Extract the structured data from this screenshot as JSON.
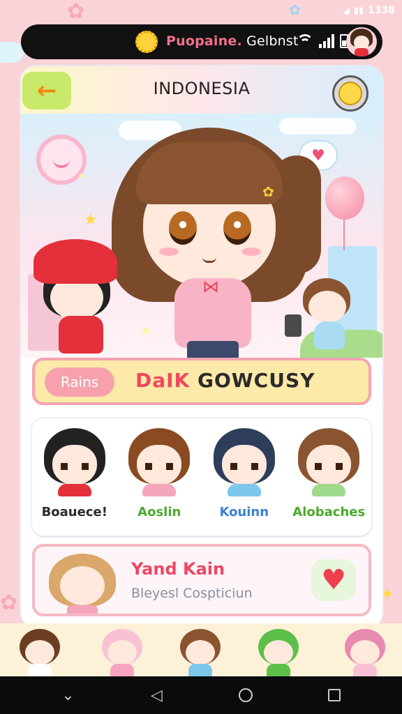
{
  "status_bar": {
    "time": "1338"
  },
  "notification": {
    "title_accent": "Puopaine.",
    "title_rest": " Gelbnst"
  },
  "header": {
    "back_icon": "arrow-left-icon",
    "title": "INDONESIA",
    "badge_icon": "coin-badge-icon"
  },
  "banner": {
    "tag": "Rains",
    "name_part1": "DaIK ",
    "name_part2": "GOWCUSY"
  },
  "friends": [
    {
      "name": "Boauece!",
      "color": "#2b2b2b",
      "hair": "#222222",
      "body": "#e3303b"
    },
    {
      "name": "Aoslin",
      "color": "#4caa2c",
      "hair": "#8a4a22",
      "body": "#f4a6bb"
    },
    {
      "name": "Kouinn",
      "color": "#3a7fd5",
      "hair": "#2d3d5a",
      "body": "#7cc7ec"
    },
    {
      "name": "Alobaches",
      "color": "#4caa2c",
      "hair": "#8a5431",
      "body": "#9fd98c"
    }
  ],
  "info_card": {
    "title": "Yand Kain",
    "subtitle": "Bleyesl Cospticiun"
  },
  "dock": {
    "characters": [
      {
        "hair": "#6b3e22",
        "body": "#ffffff"
      },
      {
        "hair": "#f9c1d6",
        "body": "#f7a4c2"
      },
      {
        "hair": "#8a5431",
        "body": "#7cc7ec"
      },
      {
        "hair": "#5cbf4a",
        "body": "#5cbf4a"
      },
      {
        "hair": "#e889b0",
        "body": "#f9c1d6"
      }
    ]
  },
  "colors": {
    "background": "#f9d3d7",
    "accent_pink": "#f0475e",
    "accent_green": "#c8e96a",
    "banner_fill": "#fde9a8"
  }
}
